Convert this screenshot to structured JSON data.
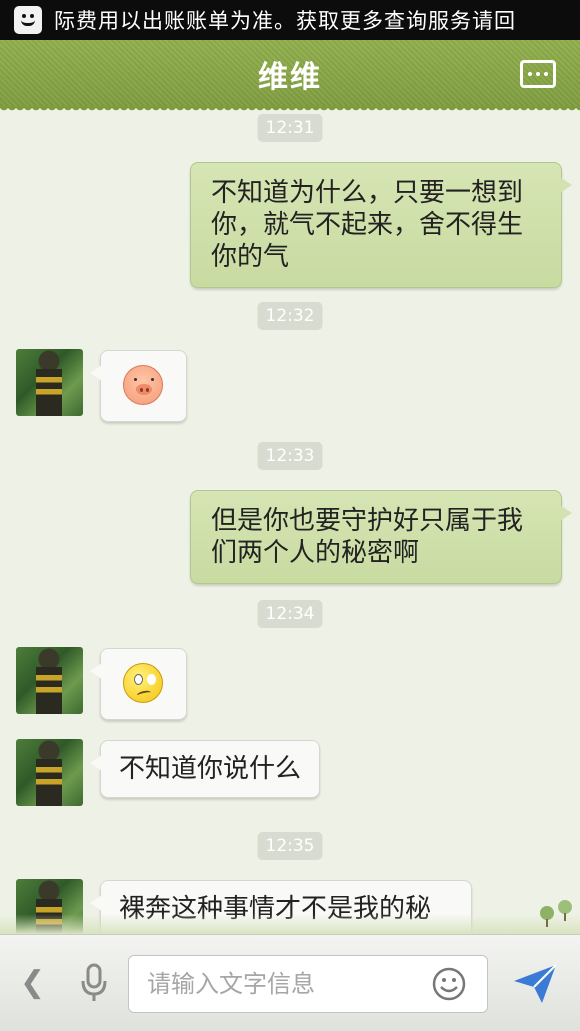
{
  "status_bar": {
    "notification_text": "际费用以出账账单为准。获取更多查询服务请回"
  },
  "header": {
    "title": "维维"
  },
  "messages": [
    {
      "type": "time",
      "text": "12:31"
    },
    {
      "type": "out",
      "text": "不知道为什么，只要一想到你，就气不起来，舍不得生你的气"
    },
    {
      "type": "time",
      "text": "12:32"
    },
    {
      "type": "in",
      "emoji": "pig-face-icon"
    },
    {
      "type": "time",
      "text": "12:33"
    },
    {
      "type": "out",
      "text": "但是你也要守护好只属于我们两个人的秘密啊"
    },
    {
      "type": "time",
      "text": "12:34"
    },
    {
      "type": "in",
      "emoji": "confused-face-icon"
    },
    {
      "type": "in",
      "text": "不知道你说什么"
    },
    {
      "type": "time",
      "text": "12:35"
    },
    {
      "type": "in",
      "text": "裸奔这种事情才不是我的秘"
    }
  ],
  "input_bar": {
    "placeholder": "请输入文字信息"
  },
  "colors": {
    "header": "#8fae4c",
    "outgoing_bubble": "#d3e2b0",
    "incoming_bubble": "#f9f9f7",
    "background": "#eef2e6",
    "send": "#3b7bd6"
  }
}
